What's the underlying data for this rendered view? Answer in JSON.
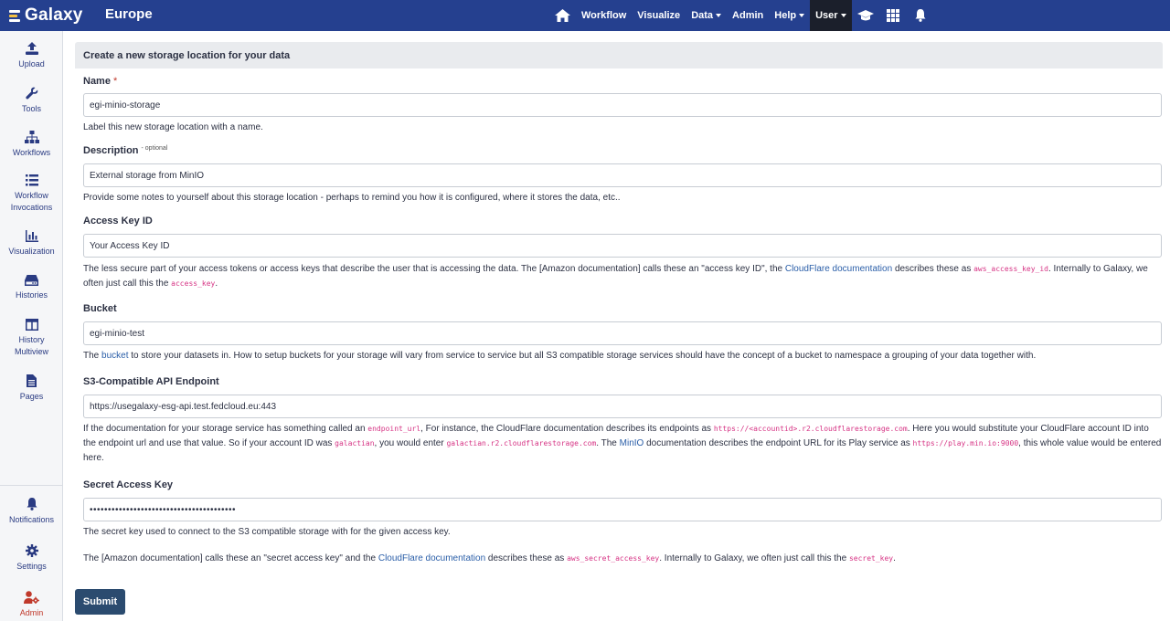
{
  "navbar": {
    "brand": "Galaxy",
    "subtitle": "Europe",
    "items": [
      {
        "label": "Workflow"
      },
      {
        "label": "Visualize"
      },
      {
        "label": "Data"
      },
      {
        "label": "Admin"
      },
      {
        "label": "Help"
      },
      {
        "label": "User"
      }
    ]
  },
  "sidebar": {
    "items": [
      {
        "label": "Upload",
        "icon": "upload-icon"
      },
      {
        "label": "Tools",
        "icon": "wrench-icon"
      },
      {
        "label": "Workflows",
        "icon": "sitemap-icon"
      },
      {
        "label": "Workflow Invocations",
        "icon": "list-icon"
      },
      {
        "label": "Visualization",
        "icon": "chart-icon"
      },
      {
        "label": "Histories",
        "icon": "hdd-icon"
      },
      {
        "label": "History Multiview",
        "icon": "columns-icon"
      },
      {
        "label": "Pages",
        "icon": "file-icon"
      },
      {
        "label": "Notifications",
        "icon": "bell-icon"
      },
      {
        "label": "Settings",
        "icon": "gear-icon"
      },
      {
        "label": "Admin",
        "icon": "user-cog-icon"
      }
    ]
  },
  "form": {
    "header": "Create a new storage location for your data",
    "name": {
      "label": "Name",
      "required_mark": "*",
      "value": "egi-minio-storage",
      "help": "Label this new storage location with a name."
    },
    "description": {
      "label": "Description",
      "optional_mark": "- optional",
      "value": "External storage from MinIO",
      "help": "Provide some notes to yourself about this storage location - perhaps to remind you how it is configured, where it stores the data, etc.."
    },
    "access_key": {
      "label": "Access Key ID",
      "value": "Your Access Key ID",
      "help1": "The less secure part of your access tokens or access keys that describe the user that is accessing the data. The [Amazon documentation] calls these an \"access key ID\", the",
      "link1": "CloudFlare documentation",
      "help2": "describes these as",
      "code1": "aws_access_key_id",
      "help3": ". Internally to Galaxy, we often just call this the",
      "code2": "access_key",
      "help4": "."
    },
    "bucket": {
      "label": "Bucket",
      "value": "egi-minio-test",
      "help1": "The",
      "link1": "bucket",
      "help2": "to store your datasets in. How to setup buckets for your storage will vary from service to service but all S3 compatible storage services should have the concept of a bucket to namespace a grouping of your data together with."
    },
    "endpoint": {
      "label": "S3-Compatible API Endpoint",
      "value": "https://usegalaxy-esg-api.test.fedcloud.eu:443",
      "help1": "If the documentation for your storage service has something called an",
      "code1": "endpoint_url",
      "help2": ", For instance, the CloudFlare documentation describes its endpoints as",
      "code2": "https://<accountid>.r2.cloudflarestorage.com",
      "help3": ". Here you would substitute your CloudFlare account ID into the endpoint url and use that value. So if your account ID was",
      "code3": "galactian",
      "help4": ", you would enter",
      "code4": "galactian.r2.cloudflarestorage.com",
      "help5": ". The",
      "link1": "MinIO",
      "help6": "documentation describes the endpoint URL for its Play service as",
      "code5": "https://play.min.io:9000",
      "help7": ", this whole value would be entered here."
    },
    "secret_key": {
      "label": "Secret Access Key",
      "value": "••••••••••••••••••••••••••••••••••••••••",
      "help": "The secret key used to connect to the S3 compatible storage with for the given access key.",
      "help_b1": "The [Amazon documentation] calls these an \"secret access key\" and the",
      "link1": "CloudFlare documentation",
      "help_b2": "describes these as",
      "code1": "aws_secret_access_key",
      "help_b3": ". Internally to Galaxy, we often just call this the",
      "code2": "secret_key",
      "help_b4": "."
    },
    "submit_label": "Submit"
  }
}
